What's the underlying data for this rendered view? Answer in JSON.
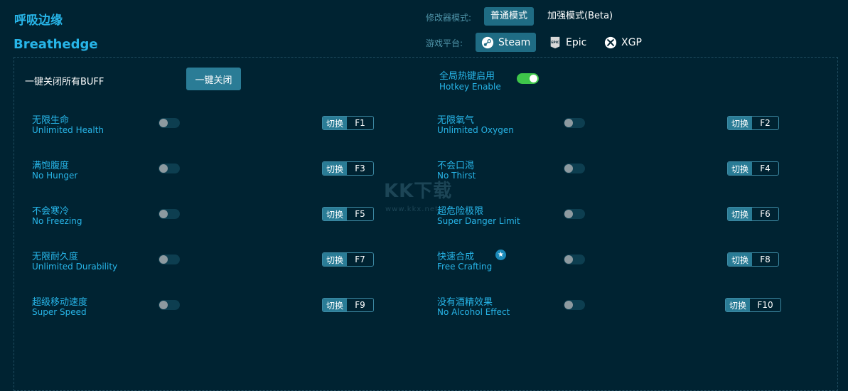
{
  "app": {
    "title_cn": "呼吸边缘",
    "title_en": "Breathedge"
  },
  "header": {
    "mode_label": "修改器模式:",
    "mode_normal": "普通模式",
    "mode_enhanced": "加强模式(Beta)",
    "platform_label": "游戏平台:",
    "platforms": [
      {
        "name": "Steam",
        "icon": "steam-icon",
        "active": true
      },
      {
        "name": "Epic",
        "icon": "epic-icon",
        "active": false
      },
      {
        "name": "XGP",
        "icon": "xbox-icon",
        "active": false
      }
    ]
  },
  "controls": {
    "onekey_label": "一键关闭所有BUFF",
    "onekey_button": "一键关闭",
    "hotkey_cn": "全局热键启用",
    "hotkey_en": "Hotkey Enable",
    "hotkey_enabled": true
  },
  "switch_label": "切换",
  "options": [
    {
      "cn": "无限生命",
      "en": "Unlimited Health",
      "key": "F1",
      "on": false
    },
    {
      "cn": "无限氧气",
      "en": "Unlimited Oxygen",
      "key": "F2",
      "on": false
    },
    {
      "cn": "满饱腹度",
      "en": "No Hunger",
      "key": "F3",
      "on": false
    },
    {
      "cn": "不会口渴",
      "en": "No Thirst",
      "key": "F4",
      "on": false
    },
    {
      "cn": "不会寒冷",
      "en": "No Freezing",
      "key": "F5",
      "on": false
    },
    {
      "cn": "超危险极限",
      "en": "Super Danger Limit",
      "key": "F6",
      "on": false
    },
    {
      "cn": "无限耐久度",
      "en": "Unlimited Durability",
      "key": "F7",
      "on": false
    },
    {
      "cn": "快速合成",
      "en": "Free Crafting",
      "key": "F8",
      "on": false,
      "starred": true
    },
    {
      "cn": "超级移动速度",
      "en": "Super Speed",
      "key": "F9",
      "on": false
    },
    {
      "cn": "没有酒精效果",
      "en": "No Alcohol Effect",
      "key": "F10",
      "on": false
    }
  ],
  "watermark": {
    "main": "KK下载",
    "sub": "www.kkx.net"
  },
  "colors": {
    "background": "#002332",
    "accent": "#27b5e8",
    "button": "#2a7c96",
    "toggle_on": "#3ec64a"
  }
}
